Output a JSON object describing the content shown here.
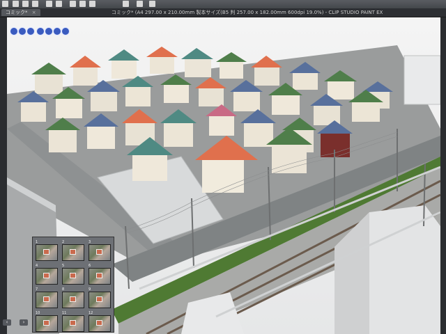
{
  "window": {
    "title": "コミック* (A4 297.00 x 210.00mm 製本サイズ(B5 判 257.00 x 182.00mm 600dpi 19.0%) - CLIP STUDIO PAINT EX",
    "tab_label": "コミック*",
    "tab_close": "×"
  },
  "toolbar": {
    "icons": [
      "menu-icon",
      "new-icon",
      "open-icon",
      "save-icon",
      "undo-icon",
      "redo-icon",
      "move-icon",
      "zoom-icon",
      "hand-icon",
      "rotate-icon",
      "settings-icon",
      "help-icon"
    ]
  },
  "viewer_controls": {
    "icons": [
      "move-object-icon",
      "rotate-camera-icon",
      "pan-camera-icon",
      "dolly-icon",
      "rotate-object-icon",
      "move-plane-icon",
      "scale-object-icon"
    ]
  },
  "thumbnails": {
    "items": [
      {
        "num": "1"
      },
      {
        "num": "2"
      },
      {
        "num": "3"
      },
      {
        "num": "4"
      },
      {
        "num": "5"
      },
      {
        "num": "6"
      },
      {
        "num": "7"
      },
      {
        "num": "8"
      },
      {
        "num": "9"
      },
      {
        "num": "10"
      },
      {
        "num": "11"
      },
      {
        "num": "12"
      }
    ],
    "nav": {
      "prev": "‹",
      "next": "›"
    }
  },
  "colors": {
    "roof_orange": "#e0704d",
    "roof_teal": "#4f8a83",
    "roof_blue": "#58709c",
    "roof_green": "#4f7e4a",
    "ground": "#8a8d8f",
    "grass": "#4f7a33"
  }
}
